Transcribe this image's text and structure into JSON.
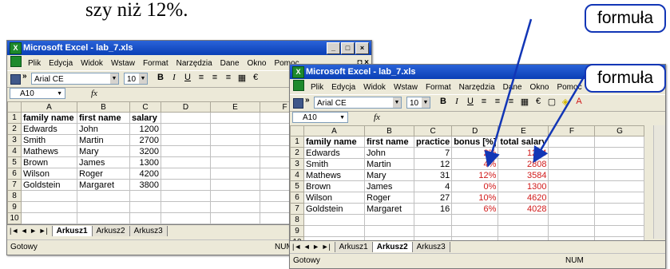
{
  "top_text": "szy niż 12%.",
  "callouts": {
    "c1": "formuła",
    "c2": "formuła"
  },
  "win1": {
    "title": "Microsoft Excel - lab_7.xls",
    "menu": [
      "Plik",
      "Edycja",
      "Widok",
      "Wstaw",
      "Format",
      "Narzędzia",
      "Dane",
      "Okno",
      "Pomoc"
    ],
    "window_controls_doc": "_ ◘ ×",
    "font": "Arial CE",
    "size": "10",
    "namebox": "A10",
    "fx": "fx",
    "columns": [
      "A",
      "B",
      "C",
      "D",
      "E",
      "F"
    ],
    "rows": [
      [
        "1",
        "family name",
        "first name",
        "salary",
        "",
        "",
        ""
      ],
      [
        "2",
        "Edwards",
        "John",
        "1200",
        "",
        "",
        ""
      ],
      [
        "3",
        "Smith",
        "Martin",
        "2700",
        "",
        "",
        ""
      ],
      [
        "4",
        "Mathews",
        "Mary",
        "3200",
        "",
        "",
        ""
      ],
      [
        "5",
        "Brown",
        "James",
        "1300",
        "",
        "",
        ""
      ],
      [
        "6",
        "Wilson",
        "Roger",
        "4200",
        "",
        "",
        ""
      ],
      [
        "7",
        "Goldstein",
        "Margaret",
        "3800",
        "",
        "",
        ""
      ],
      [
        "8",
        "",
        "",
        "",
        "",
        "",
        ""
      ],
      [
        "9",
        "",
        "",
        "",
        "",
        "",
        ""
      ],
      [
        "10",
        "",
        "",
        "",
        "",
        "",
        ""
      ]
    ],
    "tabs": [
      "Arkusz1",
      "Arkusz2",
      "Arkusz3"
    ],
    "active_tab": 0,
    "status": "Gotowy",
    "num": "NUM"
  },
  "win2": {
    "title": "Microsoft Excel - lab_7.xls",
    "menu": [
      "Plik",
      "Edycja",
      "Widok",
      "Wstaw",
      "Format",
      "Narzędzia",
      "Dane",
      "Okno",
      "Pomoc"
    ],
    "font": "Arial CE",
    "size": "10",
    "namebox": "A10",
    "fx": "fx",
    "columns": [
      "A",
      "B",
      "C",
      "D",
      "E",
      "F",
      "G"
    ],
    "rows": [
      [
        "1",
        "family name",
        "first name",
        "practice",
        "bonus [%]",
        "total salary",
        "",
        ""
      ],
      [
        "2",
        "Edwards",
        "John",
        "7",
        "2%",
        "1224",
        "",
        ""
      ],
      [
        "3",
        "Smith",
        "Martin",
        "12",
        "4%",
        "2808",
        "",
        ""
      ],
      [
        "4",
        "Mathews",
        "Mary",
        "31",
        "12%",
        "3584",
        "",
        ""
      ],
      [
        "5",
        "Brown",
        "James",
        "4",
        "0%",
        "1300",
        "",
        ""
      ],
      [
        "6",
        "Wilson",
        "Roger",
        "27",
        "10%",
        "4620",
        "",
        ""
      ],
      [
        "7",
        "Goldstein",
        "Margaret",
        "16",
        "6%",
        "4028",
        "",
        ""
      ],
      [
        "8",
        "",
        "",
        "",
        "",
        "",
        "",
        ""
      ],
      [
        "9",
        "",
        "",
        "",
        "",
        "",
        "",
        ""
      ],
      [
        "10",
        "",
        "",
        "",
        "",
        "",
        "",
        ""
      ]
    ],
    "tabs": [
      "Arkusz1",
      "Arkusz2",
      "Arkusz3"
    ],
    "active_tab": 1,
    "status": "Gotowy",
    "num": "NUM"
  },
  "colors": {
    "arrow": "#1236b6",
    "red_values": "#d11919",
    "titlebar": "#0a3fb6"
  }
}
